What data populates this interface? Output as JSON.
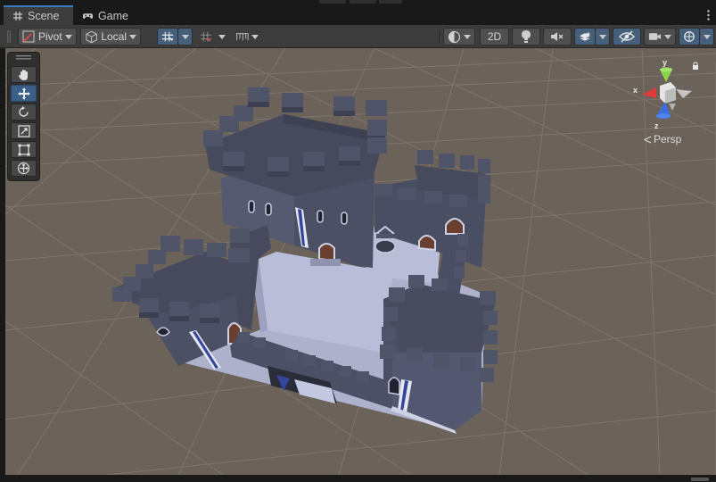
{
  "window": {
    "tabs": [
      {
        "label": "Scene",
        "icon": "grid-hash-icon",
        "active": true
      },
      {
        "label": "Game",
        "icon": "gamepad-icon",
        "active": false
      }
    ]
  },
  "toolbar": {
    "pivot_label": "Pivot",
    "local_label": "Local",
    "two_d_label": "2D",
    "icons": [
      "pivot-icon",
      "local-cube-icon",
      "grid-snap-icon",
      "grid-dropdown-icon",
      "ruler-icon",
      "shading-mode-icon",
      "light-bulb-icon",
      "audio-mute-icon",
      "effects-stack-icon",
      "visibility-icon",
      "camera-icon",
      "gizmos-icon"
    ]
  },
  "tool_palette": {
    "tools": [
      "hand-tool",
      "move-tool",
      "rotate-tool",
      "scale-tool",
      "rect-tool",
      "transform-tool"
    ],
    "selected": "move-tool"
  },
  "gizmo": {
    "axis_x": "x",
    "axis_y": "y",
    "axis_z": "z",
    "projection_label": "Persp",
    "colors": {
      "x": "#e03a3a",
      "y": "#8bd44a",
      "z": "#3a6fe0"
    }
  },
  "scene": {
    "floor_color": "#6b6359",
    "castle_color": "#4a4e60",
    "courtyard_color": "#b9bdd8"
  }
}
